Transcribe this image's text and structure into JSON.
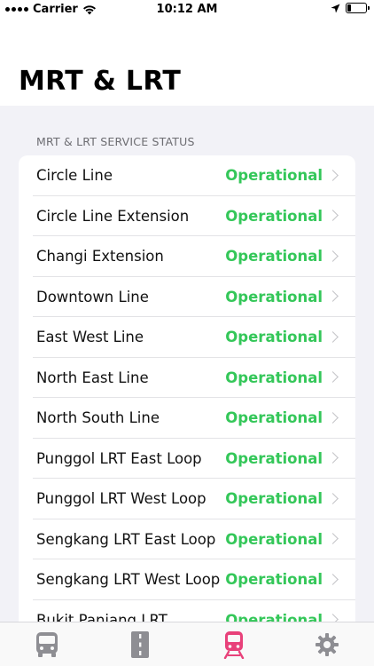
{
  "status_bar": {
    "carrier": "Carrier",
    "time": "10:12 AM",
    "battery_level": 0.2
  },
  "header": {
    "title": "MRT & LRT"
  },
  "section": {
    "header": "MRT & LRT SERVICE STATUS",
    "rows": [
      {
        "name": "Circle Line",
        "status": "Operational"
      },
      {
        "name": "Circle Line Extension",
        "status": "Operational"
      },
      {
        "name": "Changi Extension",
        "status": "Operational"
      },
      {
        "name": "Downtown Line",
        "status": "Operational"
      },
      {
        "name": "East West Line",
        "status": "Operational"
      },
      {
        "name": "North East Line",
        "status": "Operational"
      },
      {
        "name": "North South Line",
        "status": "Operational"
      },
      {
        "name": "Punggol LRT East Loop",
        "status": "Operational"
      },
      {
        "name": "Punggol LRT West Loop",
        "status": "Operational"
      },
      {
        "name": "Sengkang LRT East Loop",
        "status": "Operational"
      },
      {
        "name": "Sengkang LRT West Loop",
        "status": "Operational"
      },
      {
        "name": "Bukit Panjang LRT",
        "status": "Operational"
      }
    ]
  },
  "tab_bar": {
    "tabs": [
      {
        "icon": "bus-icon",
        "active": false
      },
      {
        "icon": "road-icon",
        "active": false
      },
      {
        "icon": "train-icon",
        "active": true
      },
      {
        "icon": "gear-icon",
        "active": false
      }
    ]
  },
  "colors": {
    "operational": "#34c759",
    "active_tab": "#e8417a",
    "inactive_tab": "#8e8e93"
  }
}
